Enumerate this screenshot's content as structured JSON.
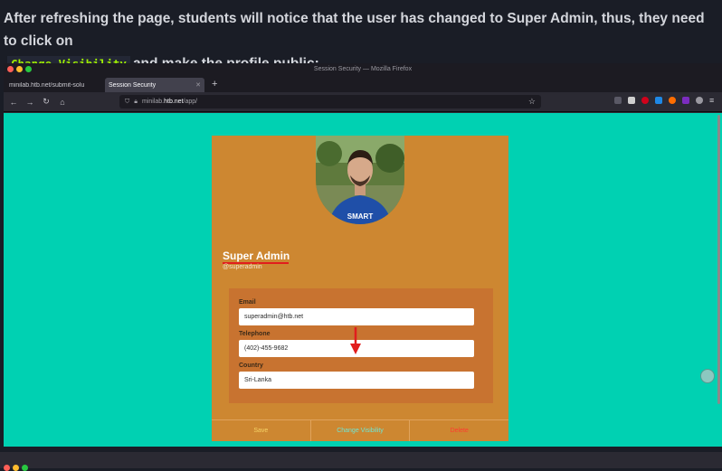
{
  "instruction": {
    "line1": "After refreshing the page, students will notice that the user has changed to Super Admin, thus, they need to click on",
    "code": "Change Visibility",
    "line2": "and make the profile public:"
  },
  "browser": {
    "window_title": "Session Security — Mozilla Firefox",
    "tabs": [
      {
        "label": "minilab.htb.net/submit-solu"
      },
      {
        "label": "Session Security"
      }
    ],
    "url_prefix": "minilab.",
    "url_host": "htb.net",
    "url_path": "/app/"
  },
  "profile": {
    "name": "Super Admin",
    "handle": "@superadmin",
    "fields": [
      {
        "label": "Email",
        "value": "superadmin@htb.net"
      },
      {
        "label": "Telephone",
        "value": "(402)-455-9682"
      },
      {
        "label": "Country",
        "value": "Sri-Lanka"
      }
    ],
    "actions": {
      "save": "Save",
      "visibility": "Change Visibility",
      "delete": "Delete"
    }
  },
  "colors": {
    "page_bg": "#00d1b2",
    "card_bg": "#cd8731",
    "info_bg": "#c87330",
    "highlight": "#e11d1d",
    "code": "#9fef00"
  }
}
